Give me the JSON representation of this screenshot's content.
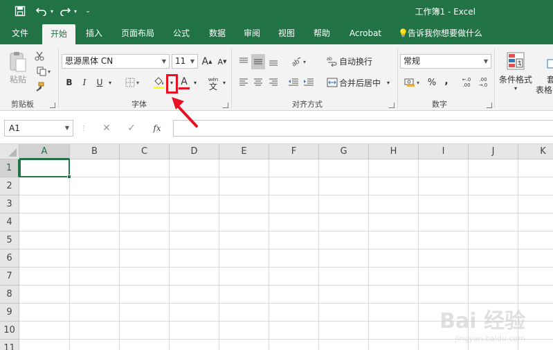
{
  "titlebar": {
    "title": "工作簿1  -  Excel",
    "save_icon": "save-icon",
    "undo_icon": "undo-icon",
    "redo_icon": "redo-icon",
    "customize_icon": "customize-quick-access-icon"
  },
  "tabs": [
    {
      "label": "文件",
      "active": false
    },
    {
      "label": "开始",
      "active": true
    },
    {
      "label": "插入",
      "active": false
    },
    {
      "label": "页面布局",
      "active": false
    },
    {
      "label": "公式",
      "active": false
    },
    {
      "label": "数据",
      "active": false
    },
    {
      "label": "审阅",
      "active": false
    },
    {
      "label": "视图",
      "active": false
    },
    {
      "label": "帮助",
      "active": false
    },
    {
      "label": "Acrobat",
      "active": false
    },
    {
      "label": "告诉我你想要做什么",
      "active": false
    }
  ],
  "ribbon": {
    "clipboard": {
      "label": "剪贴板",
      "paste_label": "粘贴"
    },
    "font": {
      "label": "字体",
      "font_name": "思源黑体 CN",
      "font_size": "11",
      "bold": "B",
      "italic": "I",
      "underline": "U",
      "font_color_letter": "A",
      "wen_label": "wén",
      "wen_char": "文"
    },
    "alignment": {
      "label": "对齐方式",
      "wrap_text": "自动换行",
      "merge_center": "合并后居中"
    },
    "number": {
      "label": "数字",
      "format": "常规",
      "percent": "%",
      "comma": ",",
      "increase_decimal": "←.0\n.00",
      "decrease_decimal": ".00\n→.0"
    },
    "styles": {
      "conditional_format": "条件格式",
      "format_table_partial": "套",
      "format_table_partial2": "表格"
    }
  },
  "formula_bar": {
    "name_box": "A1",
    "cancel": "✕",
    "enter": "✓",
    "fx": "fx",
    "value": ""
  },
  "grid": {
    "columns": [
      "A",
      "B",
      "C",
      "D",
      "E",
      "F",
      "G",
      "H",
      "I",
      "J",
      "K"
    ],
    "rows": [
      "1",
      "2",
      "3",
      "4",
      "5",
      "6",
      "7",
      "8",
      "9",
      "10",
      "11"
    ],
    "active_cell": "A1"
  },
  "watermark": {
    "main": "Bai 经验",
    "sub": "jingyan.baidu.com"
  },
  "colors": {
    "accent": "#217346",
    "highlight": "#e81123",
    "fill_yellow": "#ffff00",
    "font_red": "#e81123"
  }
}
